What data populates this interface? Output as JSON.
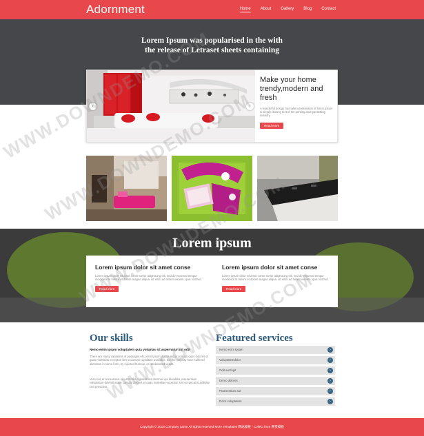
{
  "header": {
    "logo": "Adornment",
    "nav": [
      "Home",
      "About",
      "Gallery",
      "Blog",
      "Contact"
    ],
    "active_nav": "Home"
  },
  "hero": {
    "title": "Lorem Ipsum was popularised in the with the release of Letraset sheets containing"
  },
  "slider": {
    "heading": "Make your home trendy,modern and fresh",
    "description": "A wonderful design has taken possession of lorem ipsum is simply dummy text of the printing and typesetting industry.",
    "button": "Read more",
    "prev_icon": "chevron-left-icon",
    "next_icon": "chevron-right-icon"
  },
  "band": {
    "title": "Lorem ipsum",
    "columns": [
      {
        "heading": "Lorem ipsum dolor sit amet conse",
        "text": "Lorem ipsum dolor sit amet conse ctetur adipisicing elit, sed do eiusmod tempor incididunt ut labore et dolore magna aliqua. Ut enim ad minim veniam, quis nostrud.",
        "button": "Read more"
      },
      {
        "heading": "Lorem ipsum dolor sit amet conse",
        "text": "Lorem ipsum dolor sit amet conse ctetur adipisicing elit, sed do eiusmod tempor incididunt ut labore et dolore magna aliqua. Ut enim ad minim veniam, quis nostrud.",
        "button": "Read more"
      }
    ]
  },
  "skills": {
    "title": "Our skills",
    "subtitle": "Nemo enim ipsam voluptatem quia voluptas sit aspernatur aut odit",
    "paragraphs": [
      "There are many variations of passages of Lorem Ipsum dolore atque corrupti quos dolores et quas molestias excepturi sint occaecati cupiditate available, but the majority have suffered alteration in some form, by injected humour, or randomised words.",
      "Vero eos et accusamus et iusto odio dignissimos ducimus qui blanditiis praesentium voluptatum deleniti atque corrupti dolores et quas molestias excepturi sint occaecati cupiditate non provident."
    ]
  },
  "services": {
    "title": "Featured services",
    "items": [
      "Nemo enim ipsam",
      "Voluptatemdolor",
      "Odit aut fugit",
      "Demo dolores",
      "Praesentium aut",
      "Dolor voluptatem"
    ],
    "arrow_icon": "chevron-right-icon"
  },
  "footer": {
    "text": "Copyright © 2015 Company name All rights reserved More Templates 网站模板 - Collect from 网页模板"
  },
  "watermark": "WWW.DOWNDEMO.COM",
  "colors": {
    "accent": "#e8484b",
    "dark": "#46474a",
    "heading_blue": "#2c5a7c",
    "service_bg": "#e3e3e3"
  }
}
